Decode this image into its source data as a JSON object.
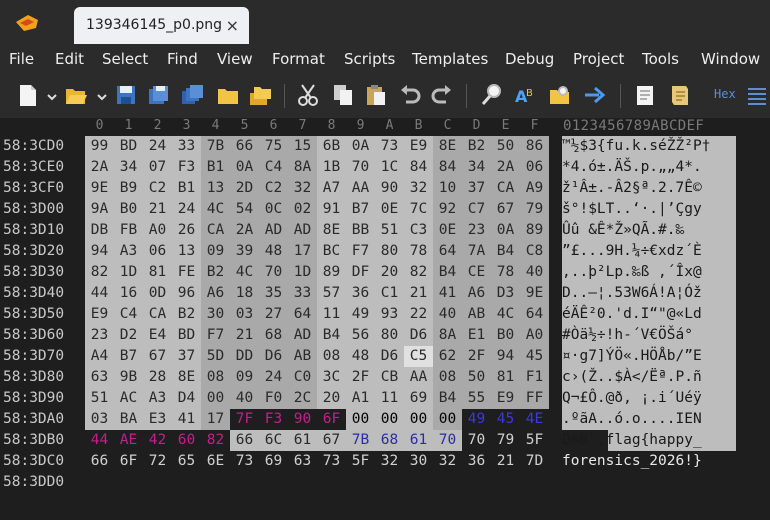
{
  "tab": {
    "title": "139346145_p0.png",
    "close": "×"
  },
  "menu": [
    "File",
    "Edit",
    "Select",
    "Find",
    "View",
    "Format",
    "Scripts",
    "Templates",
    "Debug",
    "Project",
    "Tools",
    "Window"
  ],
  "toolbar": {
    "hex_label": "Hex"
  },
  "editor": {
    "columns": [
      "0",
      "1",
      "2",
      "3",
      "4",
      "5",
      "6",
      "7",
      "8",
      "9",
      "A",
      "B",
      "C",
      "D",
      "E",
      "F"
    ],
    "ascii_header": "0123456789ABCDEF",
    "rows": [
      {
        "addr": "58:3CD0",
        "bytes": [
          "99",
          "BD",
          "24",
          "33",
          "7B",
          "66",
          "75",
          "15",
          "6B",
          "0A",
          "73",
          "E9",
          "8E",
          "B2",
          "50",
          "86"
        ],
        "ascii": "™½$3{fu.k.séŽŽ²P†"
      },
      {
        "addr": "58:3CE0",
        "bytes": [
          "2A",
          "34",
          "07",
          "F3",
          "B1",
          "0A",
          "C4",
          "8A",
          "1B",
          "70",
          "1C",
          "84",
          "84",
          "34",
          "2A",
          "06"
        ],
        "ascii": "*4.ó±.ÄŠ.p.„„4*."
      },
      {
        "addr": "58:3CF0",
        "bytes": [
          "9E",
          "B9",
          "C2",
          "B1",
          "13",
          "2D",
          "C2",
          "32",
          "A7",
          "AA",
          "90",
          "32",
          "10",
          "37",
          "CA",
          "A9"
        ],
        "ascii": "ž¹Â±.-Â2§ª.2.7Ê©"
      },
      {
        "addr": "58:3D00",
        "bytes": [
          "9A",
          "B0",
          "21",
          "24",
          "4C",
          "54",
          "0C",
          "02",
          "91",
          "B7",
          "0E",
          "7C",
          "92",
          "C7",
          "67",
          "79"
        ],
        "ascii": "š°!$LT..‘·.|’Çgy"
      },
      {
        "addr": "58:3D10",
        "bytes": [
          "DB",
          "FB",
          "A0",
          "26",
          "CA",
          "2A",
          "AD",
          "AD",
          "8E",
          "BB",
          "51",
          "C3",
          "0E",
          "23",
          "0A",
          "89"
        ],
        "ascii": "Ûû &Ê*­­Ž»QÃ.#.‰"
      },
      {
        "addr": "58:3D20",
        "bytes": [
          "94",
          "A3",
          "06",
          "13",
          "09",
          "39",
          "48",
          "17",
          "BC",
          "F7",
          "80",
          "78",
          "64",
          "7A",
          "B4",
          "C8"
        ],
        "ascii": "”£...9H.¼÷€xdz´È"
      },
      {
        "addr": "58:3D30",
        "bytes": [
          "82",
          "1D",
          "81",
          "FE",
          "B2",
          "4C",
          "70",
          "1D",
          "89",
          "DF",
          "20",
          "82",
          "B4",
          "CE",
          "78",
          "40"
        ],
        "ascii": "‚..þ²Lp.‰ß ‚´Îx@"
      },
      {
        "addr": "58:3D40",
        "bytes": [
          "44",
          "16",
          "0D",
          "96",
          "A6",
          "18",
          "35",
          "33",
          "57",
          "36",
          "C1",
          "21",
          "41",
          "A6",
          "D3",
          "9E"
        ],
        "ascii": "D..–¦.53W6Á!A¦Óž"
      },
      {
        "addr": "58:3D50",
        "bytes": [
          "E9",
          "C4",
          "CA",
          "B2",
          "30",
          "03",
          "27",
          "64",
          "11",
          "49",
          "93",
          "22",
          "40",
          "AB",
          "4C",
          "64"
        ],
        "ascii": "éÄÊ²0.'d.I“\"@«Ld"
      },
      {
        "addr": "58:3D60",
        "bytes": [
          "23",
          "D2",
          "E4",
          "BD",
          "F7",
          "21",
          "68",
          "AD",
          "B4",
          "56",
          "80",
          "D6",
          "8A",
          "E1",
          "B0",
          "A0"
        ],
        "ascii": "#Òä½÷!h-´V€ÖŠá° "
      },
      {
        "addr": "58:3D70",
        "bytes": [
          "A4",
          "B7",
          "67",
          "37",
          "5D",
          "DD",
          "D6",
          "AB",
          "08",
          "48",
          "D6",
          "C5",
          "62",
          "2F",
          "94",
          "45"
        ],
        "ascii": "¤·g7]ÝÖ«.HÖÅb/”E"
      },
      {
        "addr": "58:3D80",
        "bytes": [
          "63",
          "9B",
          "28",
          "8E",
          "08",
          "09",
          "24",
          "C0",
          "3C",
          "2F",
          "CB",
          "AA",
          "08",
          "50",
          "81",
          "F1"
        ],
        "ascii": "c›(Ž..$À</Ëª.P.ñ"
      },
      {
        "addr": "58:3D90",
        "bytes": [
          "51",
          "AC",
          "A3",
          "D4",
          "00",
          "40",
          "F0",
          "2C",
          "20",
          "A1",
          "11",
          "69",
          "B4",
          "55",
          "E9",
          "FF"
        ],
        "ascii": "Q¬£Ô.@ð, ¡.i´Uéÿ"
      },
      {
        "addr": "58:3DA0",
        "bytes": [
          "03",
          "BA",
          "E3",
          "41",
          "17",
          "7F",
          "F3",
          "90",
          "6F",
          "00",
          "00",
          "00",
          "00",
          "49",
          "45",
          "4E"
        ],
        "ascii": ".ºãA..ó.o....IEN"
      },
      {
        "addr": "58:3DB0",
        "bytes": [
          "44",
          "AE",
          "42",
          "60",
          "82",
          "66",
          "6C",
          "61",
          "67",
          "7B",
          "68",
          "61",
          "70",
          "70",
          "79",
          "5F"
        ],
        "ascii": "D®B`‚flag{happy_"
      },
      {
        "addr": "58:3DC0",
        "bytes": [
          "66",
          "6F",
          "72",
          "65",
          "6E",
          "73",
          "69",
          "63",
          "73",
          "5F",
          "32",
          "30",
          "32",
          "36",
          "21",
          "7D"
        ],
        "ascii": "forensics_2026!}"
      },
      {
        "addr": "58:3DD0",
        "bytes": [],
        "ascii": ""
      }
    ]
  },
  "colors": {
    "background": "#1e1e1e",
    "selection": "#bdbdbd",
    "pink": "#b01c8e",
    "blue": "#2b2ba8",
    "hex_label": "#5b8fd1"
  },
  "icons": [
    "new-file-icon",
    "open-folder-icon",
    "save-icon",
    "save-as-icon",
    "save-all-icon",
    "folder-icon",
    "folders-icon",
    "cut-icon",
    "copy-icon",
    "paste-icon",
    "undo-icon",
    "redo-icon",
    "find-icon",
    "replace-icon",
    "find-in-files-icon",
    "goto-icon",
    "templates-icon",
    "hex-toggle-icon"
  ]
}
